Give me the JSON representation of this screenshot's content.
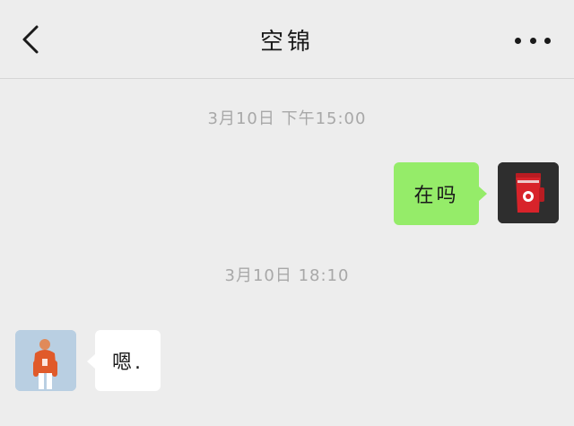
{
  "header": {
    "title": "空锦",
    "back_icon": "chevron-left-icon",
    "more_icon": "more-horizontal-icon"
  },
  "messages": [
    {
      "timestamp": "3月10日 下午15:00",
      "direction": "outgoing",
      "text": "在吗",
      "avatar": "red-cup-avatar"
    },
    {
      "timestamp": "3月10日 18:10",
      "direction": "incoming",
      "text": "嗯.",
      "avatar": "person-orange-hoodie-avatar"
    }
  ],
  "colors": {
    "background": "#ededed",
    "outgoing_bubble": "#95ec69",
    "incoming_bubble": "#ffffff",
    "timestamp_text": "#a8a8a8"
  }
}
